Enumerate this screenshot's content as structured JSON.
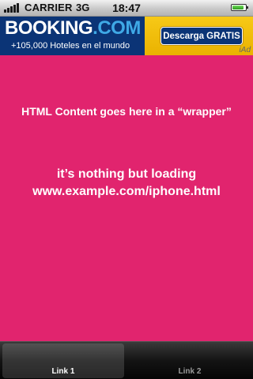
{
  "status_bar": {
    "carrier": "CARRIER",
    "network": "3G",
    "time": "18:47"
  },
  "ad": {
    "brand_main": "BOOKING",
    "brand_accent": ".COM",
    "subtitle": "+105,000 Hoteles en el mundo",
    "cta": "Descarga GRATIS",
    "network_label": "iAd",
    "colors": {
      "brand_blue": "#0b3476",
      "accent_blue": "#3fa9e6",
      "cta_yellow": "#f2be0b"
    }
  },
  "content": {
    "heading": "HTML Content goes here in a “wrapper”",
    "line1": "it’s nothing but loading",
    "line2": "www.example.com/iphone.html",
    "background_color": "#e1246e"
  },
  "tab_bar": {
    "tabs": [
      {
        "label": "Link 1",
        "selected": true
      },
      {
        "label": "Link 2",
        "selected": false
      }
    ]
  }
}
